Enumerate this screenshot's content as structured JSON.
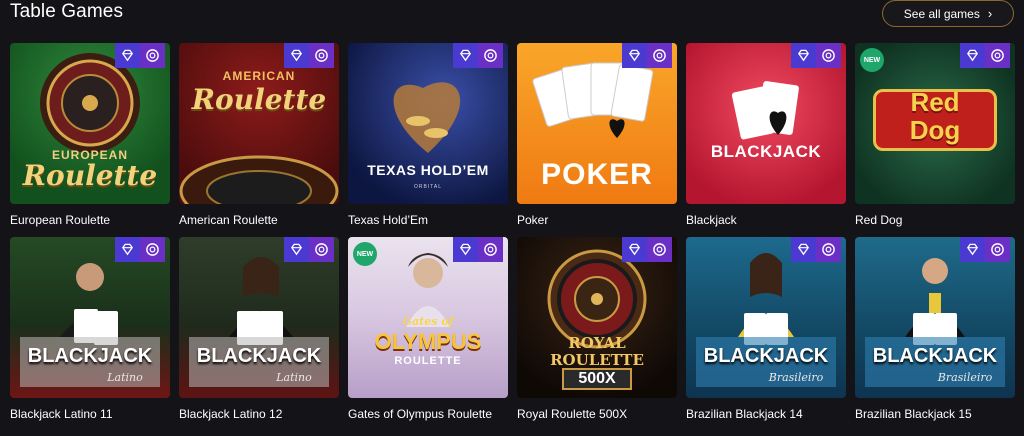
{
  "section": {
    "title": "Table Games",
    "see_all": "See all games",
    "see_all_icon": "chevron-right-icon"
  },
  "badges": {
    "gem_icon": "diamond-icon",
    "chip_icon": "chip-icon",
    "new_label": "NEW"
  },
  "rows": [
    [
      {
        "title": "European Roulette",
        "art_line1": "EUROPEAN",
        "art_line2": "Roulette",
        "is_new": false
      },
      {
        "title": "American Roulette",
        "art_line1": "AMERICAN",
        "art_line2": "Roulette",
        "is_new": false
      },
      {
        "title": "Texas Hold’Em",
        "art_line1": "TEXAS HOLD’EM",
        "art_line2": "ORBITAL",
        "is_new": false
      },
      {
        "title": "Poker",
        "art_line1": "POKER",
        "art_line2": "",
        "is_new": false
      },
      {
        "title": "Blackjack",
        "art_line1": "BLACKJACK",
        "art_line2": "",
        "is_new": false
      },
      {
        "title": "Red Dog",
        "art_line1": "Red",
        "art_line2": "Dog",
        "is_new": true
      }
    ],
    [
      {
        "title": "Blackjack Latino 11",
        "art_line1": "BLACKJACK",
        "art_line2": "Latino",
        "is_new": false
      },
      {
        "title": "Blackjack Latino 12",
        "art_line1": "BLACKJACK",
        "art_line2": "Latino",
        "is_new": false
      },
      {
        "title": "Gates of Olympus Roulette",
        "art_line1": "OLYMPUS",
        "art_line2": "ROULETTE",
        "art_line0": "Gates of",
        "is_new": true
      },
      {
        "title": "Royal Roulette 500X",
        "art_line1": "ROYAL ROULETTE",
        "art_line2": "500X",
        "is_new": false
      },
      {
        "title": "Brazilian Blackjack 14",
        "art_line1": "BLACKJACK",
        "art_line2": "Brasileiro",
        "is_new": false
      },
      {
        "title": "Brazilian Blackjack 15",
        "art_line1": "BLACKJACK",
        "art_line2": "Brasileiro",
        "is_new": false
      }
    ]
  ]
}
